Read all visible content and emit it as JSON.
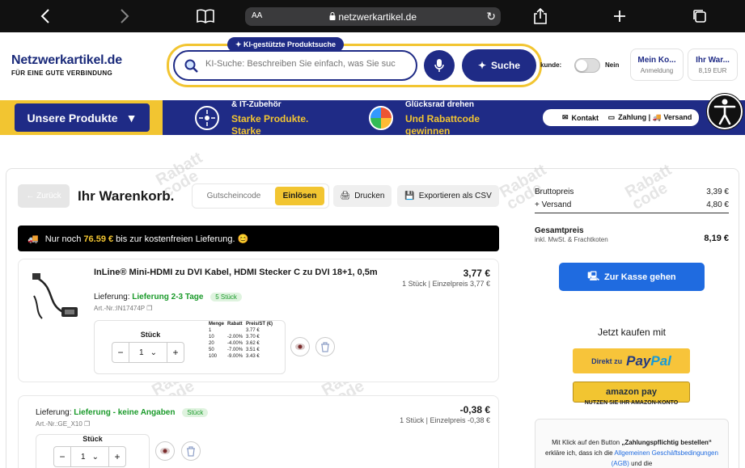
{
  "browser": {
    "text_size_label": "AA",
    "url": "netzwerkartikel.de"
  },
  "header": {
    "logo_title": "Netzwerkartikel.de",
    "logo_tagline": "FÜR EINE GUTE VERBINDUNG",
    "ai_badge": "KI-gestützte Produktsuche",
    "search_placeholder": "KI-Suche: Beschreiben Sie einfach, was Sie suc",
    "search_button": "Suche",
    "express_label": "kunde:",
    "express_value": "Nein",
    "account_title": "Mein Ko...",
    "account_sub": "Anmeldung",
    "cart_title": "Ihr War...",
    "cart_sub": "8,19 EUR"
  },
  "nav": {
    "products_button": "Unsere Produkte",
    "banner1_line1": "& IT-Zubehör",
    "banner1_line2": "Starke Produkte.",
    "banner1_line3": "Starke",
    "banner2_line1": "Glücksrad drehen",
    "banner2_line2": "Und Rabattcode",
    "banner2_line3": "gewinnen",
    "contact_pill": "Kontakt",
    "payment_pill": "Zahlung | 🚚 Versand"
  },
  "cart": {
    "back_button": "← Zurück",
    "title": "Ihr Warenkorb.",
    "coupon_placeholder": "Gutscheincode",
    "redeem_button": "Einlösen",
    "print_button": "Drucken",
    "export_button": "Exportieren als CSV",
    "shipping_prefix": "Nur noch",
    "shipping_amount": "76.59 €",
    "shipping_suffix": "bis zur kostenfreien Lieferung. 😊",
    "items": [
      {
        "title": "InLine® Mini-HDMI zu DVI Kabel, HDMI Stecker C zu DVI 18+1, 0,5m",
        "delivery_label": "Lieferung:",
        "delivery_value": "Lieferung 2-3 Tage",
        "stock_tag": "5 Stück",
        "article": "Art.-Nr.:IN17474P",
        "price": "3,77 €",
        "price_sub": "1 Stück | Einzelpreis 3,77 €",
        "qty_label": "Stück",
        "qty_value": "1",
        "price_table": {
          "headers": [
            "Menge",
            "Rabatt",
            "Preis/ST (€)"
          ],
          "rows": [
            [
              "1",
              "",
              "3.77 €"
            ],
            [
              "10",
              "-2.00%",
              "3.70 €"
            ],
            [
              "20",
              "-4.00%",
              "3.62 €"
            ],
            [
              "50",
              "-7.00%",
              "3.51 €"
            ],
            [
              "100",
              "-9.00%",
              "3.43 €"
            ]
          ]
        }
      },
      {
        "delivery_label": "Lieferung:",
        "delivery_value": "Lieferung - keine Angaben",
        "stock_tag": "Stück",
        "article": "Art.-Nr.:GE_X10",
        "price": "-0,38 €",
        "price_sub": "1 Stück | Einzelpreis -0,38 €",
        "qty_label": "Stück",
        "qty_value": "1"
      }
    ]
  },
  "summary": {
    "brutto_label": "Bruttopreis",
    "brutto_value": "3,39 €",
    "versand_label": "+ Versand",
    "versand_value": "4,80 €",
    "total_label": "Gesamtpreis",
    "total_sub": "inkl. MwSt. & Frachtkoten",
    "total_value": "8,19 €",
    "checkout_button": "Zur Kasse gehen",
    "buy_now": "Jetzt kaufen mit",
    "paypal_prefix": "Direkt zu",
    "paypal_brand_pay": "Pay",
    "paypal_brand_pal": "Pal",
    "amazon_button": "amazon pay",
    "amazon_sub": "NUTZEN SIE IHR AMAZON-KONTO",
    "legal_1": "Mit Klick auf den Button",
    "legal_2": "„Zahlungspflichtig bestellen“",
    "legal_3": "erkläre ich, dass ich die",
    "legal_4": "Allgemeinen Geschäftsbedingungen (AGB)",
    "legal_5": "und die"
  },
  "watermark": {
    "line1": "Rabatt",
    "line2": "code"
  },
  "colors": {
    "brand_blue": "#1f2b86",
    "accent_yellow": "#f2c531",
    "checkout_blue": "#1f6be0",
    "stock_green": "#1a9a2a"
  }
}
